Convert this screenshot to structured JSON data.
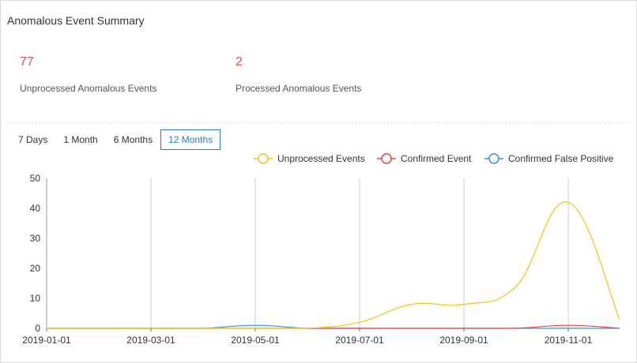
{
  "panel": {
    "title": "Anomalous Event Summary"
  },
  "stats": [
    {
      "value": "77",
      "label": "Unprocessed Anomalous Events"
    },
    {
      "value": "2",
      "label": "Processed Anomalous Events"
    }
  ],
  "tabs": [
    {
      "label": "7 Days",
      "active": false
    },
    {
      "label": "1 Month",
      "active": false
    },
    {
      "label": "6 Months",
      "active": false
    },
    {
      "label": "12 Months",
      "active": true
    }
  ],
  "chart_data": {
    "type": "line",
    "x": [
      "2019-01-01",
      "2019-02-01",
      "2019-03-01",
      "2019-04-01",
      "2019-05-01",
      "2019-06-01",
      "2019-07-01",
      "2019-08-01",
      "2019-09-01",
      "2019-10-01",
      "2019-11-01",
      "2019-12-01"
    ],
    "x_tick_labels": [
      "2019-01-01",
      "2019-03-01",
      "2019-05-01",
      "2019-07-01",
      "2019-09-01",
      "2019-11-01"
    ],
    "y_tick_labels": [
      "0",
      "10",
      "20",
      "30",
      "40",
      "50"
    ],
    "ylim": [
      0,
      50
    ],
    "grid": "vertical",
    "legend_position": "top-right",
    "series": [
      {
        "name": "Unprocessed Events",
        "color": "#f0c419",
        "values": [
          0,
          0,
          0,
          0,
          0,
          0,
          2,
          8,
          8,
          14,
          42,
          3
        ]
      },
      {
        "name": "Confirmed Event",
        "color": "#e2473a",
        "values": [
          0,
          0,
          0,
          0,
          0,
          0,
          0,
          0,
          0,
          0,
          1,
          0
        ]
      },
      {
        "name": "Confirmed False Positive",
        "color": "#3b8fdb",
        "values": [
          0,
          0,
          0,
          0,
          1,
          0,
          0,
          0,
          0,
          0,
          0,
          0
        ]
      }
    ]
  }
}
